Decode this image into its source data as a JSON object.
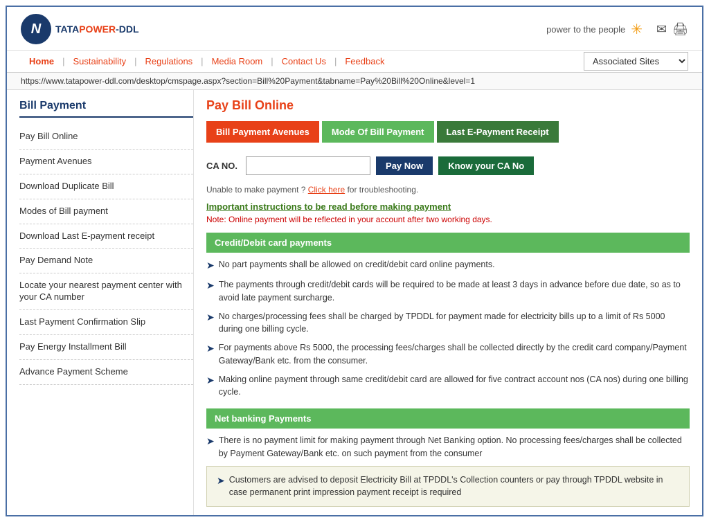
{
  "header": {
    "logo_letter": "N",
    "logo_brand": "TATAPOWER-DDL",
    "tagline": "power to the people",
    "url": "https://www.tatapower-ddl.com/desktop/cmspage.aspx?section=Bill%20Payment&tabname=Pay%20Bill%20Online&level=1"
  },
  "nav": {
    "links": [
      {
        "label": "Home",
        "active": true
      },
      {
        "label": "Sustainability",
        "active": false
      },
      {
        "label": "Regulations",
        "active": false
      },
      {
        "label": "Media Room",
        "active": false
      },
      {
        "label": "Contact Us",
        "active": false
      },
      {
        "label": "Feedback",
        "active": false
      }
    ],
    "associated_sites_label": "Associated Sites",
    "dropdown_arrow": "▼"
  },
  "sidebar": {
    "title": "Bill Payment",
    "items": [
      "Pay Bill Online",
      "Payment Avenues",
      "Download Duplicate Bill",
      "Modes of Bill payment",
      "Download Last E-payment receipt",
      "Pay Demand Note",
      "Locate your nearest payment center with your CA number",
      "Last Payment Confirmation Slip",
      "Pay Energy Installment Bill",
      "Advance Payment Scheme"
    ]
  },
  "content": {
    "title": "Pay Bill Online",
    "tabs": [
      {
        "label": "Bill Payment Avenues",
        "style": "orange"
      },
      {
        "label": "Mode Of Bill Payment",
        "style": "green"
      },
      {
        "label": "Last E-Payment Receipt",
        "style": "dark-green"
      }
    ],
    "ca_label": "CA NO.",
    "ca_placeholder": "",
    "pay_now_label": "Pay Now",
    "know_ca_label": "Know your CA No",
    "trouble_text": "Unable to make payment ?",
    "click_here": "Click here",
    "trouble_suffix": "for troubleshooting.",
    "important_link": "Important instructions to be read before making payment",
    "note": "Note: Online payment will be reflected in your account after two working days.",
    "sections": [
      {
        "header": "Credit/Debit card payments",
        "bullets": [
          "No part payments shall be allowed on credit/debit card online payments.",
          "The payments through credit/debit cards will be required to be made at least 3 days in advance before due date, so as to avoid late payment surcharge.",
          "No charges/processing fees shall be charged by TPDDL for payment made for electricity bills up to a limit of Rs 5000 during one billing cycle.",
          "For payments above Rs 5000, the processing fees/charges shall be collected directly by the credit card company/Payment Gateway/Bank etc. from the consumer.",
          "Making online payment through same credit/debit card are allowed for five contract account nos (CA nos) during one billing cycle."
        ]
      },
      {
        "header": "Net banking Payments",
        "bullets": [
          "There is no payment limit for making payment through Net Banking option. No processing fees/charges shall be collected by Payment Gateway/Bank etc. on such payment from the consumer"
        ]
      }
    ],
    "bottom_bullet": "Customers are advised to deposit Electricity Bill at TPDDL's Collection counters or pay through TPDDL website in case permanent print impression payment receipt is required"
  }
}
